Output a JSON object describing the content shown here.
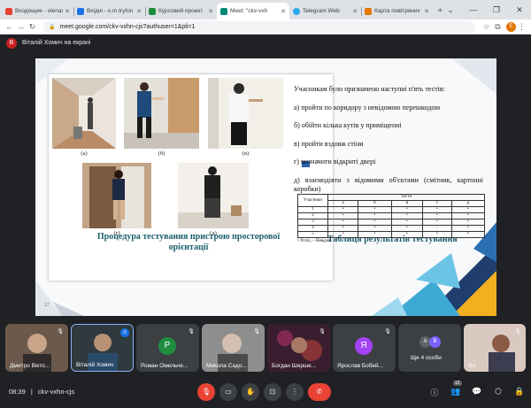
{
  "browser": {
    "tabs": [
      {
        "label": "Входящие - olenaх",
        "favicon_color": "#ea4335",
        "active": false
      },
      {
        "label": "Вхідні - o.m.tryfon",
        "favicon_color": "#1a73e8",
        "active": false
      },
      {
        "label": "Курсовий проект",
        "favicon_color": "#1e8e3e",
        "active": false
      },
      {
        "label": "Meet: \"ckv-vxh",
        "favicon_color": "#00897b",
        "active": true
      },
      {
        "label": "Telegram Web",
        "favicon_color": "#29a9eb",
        "active": false
      },
      {
        "label": "Карта повітряних т",
        "favicon_color": "#e37400",
        "active": false
      }
    ],
    "new_tab": "+",
    "url": "meet.google.com/ckv-vxhn-cjs?authuser=1&pli=1",
    "profile_initial": "E"
  },
  "presenter": {
    "initial": "В",
    "text": "Віталій Хомич на екрані"
  },
  "slide": {
    "photos": [
      "(а)",
      "(б)",
      "(в)",
      "(г)",
      "(д)"
    ],
    "caption_left": "Процедура тестування пристрою просторової орієнтації",
    "caption_right": "Таблиця результатів тестування",
    "intro": "Учасникам було призначено наступні п'ять тестів:",
    "tests": [
      "а) пройти по коридору з невідомою перешкодою",
      "б) обійти кілька кутів у приміщенні",
      "в) пройти вздовж стіни",
      "г) визначити відкриті двері",
      "д) взаємодіяти з відомими об'єктами (смітник, картонні коробки)"
    ],
    "table": {
      "header_group": "Тести",
      "header_row": "Учасники",
      "columns": [
        "а",
        "б",
        "в",
        "г",
        "д"
      ],
      "rows": [
        {
          "id": "1",
          "marks": [
            "•",
            "•",
            "•",
            "•",
            "•"
          ]
        },
        {
          "id": "2",
          "marks": [
            "•",
            "•",
            "•",
            "•",
            "•"
          ]
        },
        {
          "id": "3",
          "marks": [
            "•",
            "•",
            "•",
            "•",
            "•"
          ]
        },
        {
          "id": "4",
          "marks": [
            "•",
            "•",
            "•",
            "-",
            "•"
          ]
        },
        {
          "id": "5",
          "marks": [
            "•",
            "•",
            "•",
            "•",
            "•"
          ]
        }
      ],
      "legend": "• Успіх, – Невдача"
    },
    "page_number": "17"
  },
  "participants": [
    {
      "name": "Дмитро Вікто...",
      "initial": "",
      "color": "#6b5a4c",
      "muted": true
    },
    {
      "name": "Віталій Хомич",
      "initial": "",
      "color": "#2f3a3f",
      "muted": false
    },
    {
      "name": "Роман Омельче...",
      "initial": "Р",
      "color": "#1e8e3e",
      "muted": true
    },
    {
      "name": "Микола Садо...",
      "initial": "",
      "color": "#8e8e8e",
      "muted": true
    },
    {
      "name": "Богдан Шерше...",
      "initial": "",
      "color": "#4a2a3a",
      "muted": true
    },
    {
      "name": "Ярослав Бобей...",
      "initial": "Я",
      "color": "#a142f4",
      "muted": true
    },
    {
      "name": "Ще 4 особи",
      "initial": "",
      "color": "#3c4043",
      "muted": false
    },
    {
      "name": "Ви",
      "initial": "",
      "color": "#d9c9c0",
      "muted": true
    }
  ],
  "more_avatars": [
    "А",
    "В"
  ],
  "meeting": {
    "time": "08:39",
    "code": "ckv-vxhn-cjs",
    "people_count": "12"
  }
}
